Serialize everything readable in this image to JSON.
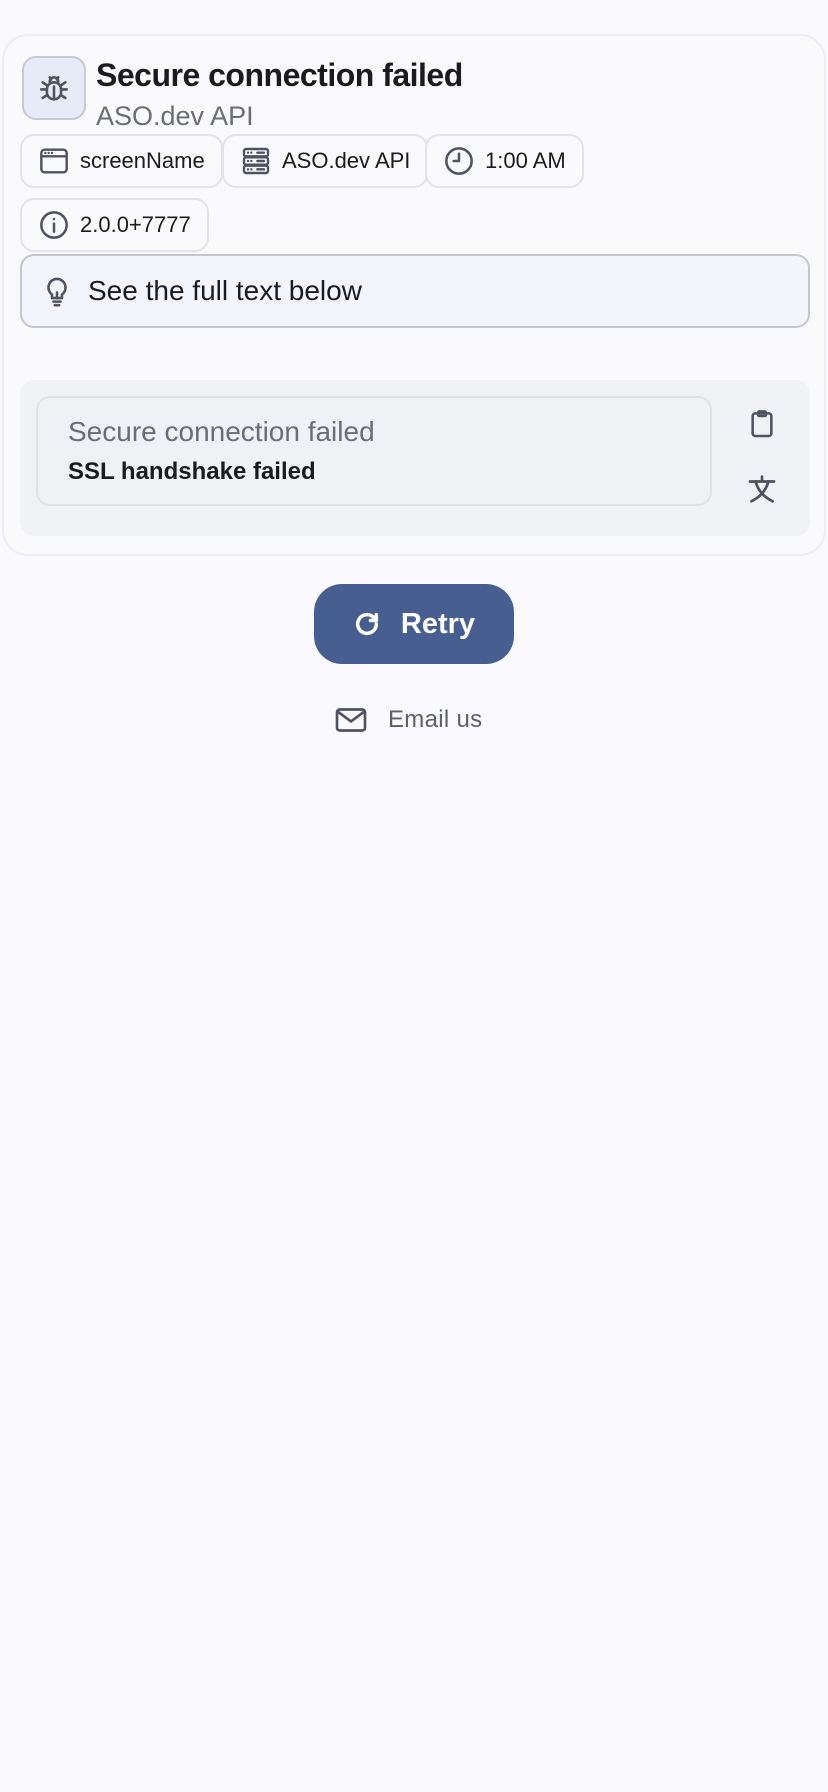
{
  "error": {
    "title": "Secure connection failed",
    "subtitle": "ASO.dev API"
  },
  "chips": {
    "screen": "screenName",
    "service": "ASO.dev API",
    "time": "1:00 AM",
    "version": "2.0.0+7777"
  },
  "hint": {
    "text": "See the full text below"
  },
  "message": {
    "title": "Secure connection failed",
    "detail": "SSL handshake failed"
  },
  "actions": {
    "retry_label": "Retry",
    "email_label": "Email us"
  },
  "icons": {
    "header": "bug-icon",
    "screen": "window-icon",
    "service": "server-icon",
    "time": "clock-icon",
    "version": "info-icon",
    "hint": "lightbulb-icon",
    "copy": "clipboard-icon",
    "translate": "translate-icon",
    "retry": "refresh-icon",
    "email": "mail-icon"
  },
  "colors": {
    "primary": "#475f90",
    "background": "#f9f9fe",
    "hint_background": "#f3f4fc"
  }
}
